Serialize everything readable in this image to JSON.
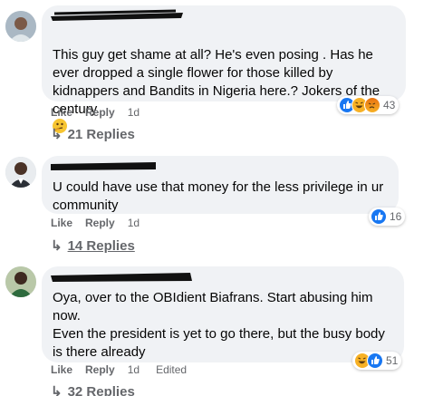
{
  "comments": [
    {
      "text": "This guy get shame at all? He's even posing . Has he ever dropped a single flower for those killed by kidnappers and Bandits in Nigeria here.? Jokers of the century",
      "like": "Like",
      "reply": "Reply",
      "time": "1d",
      "reaction_count": "43",
      "reaction_icons": [
        "like-icon",
        "haha-icon",
        "angry-icon"
      ],
      "replies": "21 Replies"
    },
    {
      "text": "U could have use that money for the less privilege in ur community",
      "like": "Like",
      "reply": "Reply",
      "time": "1d",
      "reaction_count": "16",
      "reaction_icons": [
        "like-icon"
      ],
      "replies": "14 Replies"
    },
    {
      "text": "Oya, over to the OBIdient Biafrans. Start abusing him now.\nEven the president is yet to go there, but the busy body is there already",
      "like": "Like",
      "reply": "Reply",
      "time": "1d",
      "edited": "Edited",
      "reaction_count": "51",
      "reaction_icons": [
        "haha-icon",
        "like-icon"
      ],
      "replies": "32 Replies"
    }
  ],
  "colors": {
    "bubble": "#f0f2f5",
    "meta_text": "#65676b",
    "like_blue": "#1877f2",
    "haha_yellow": "#f7b125"
  }
}
